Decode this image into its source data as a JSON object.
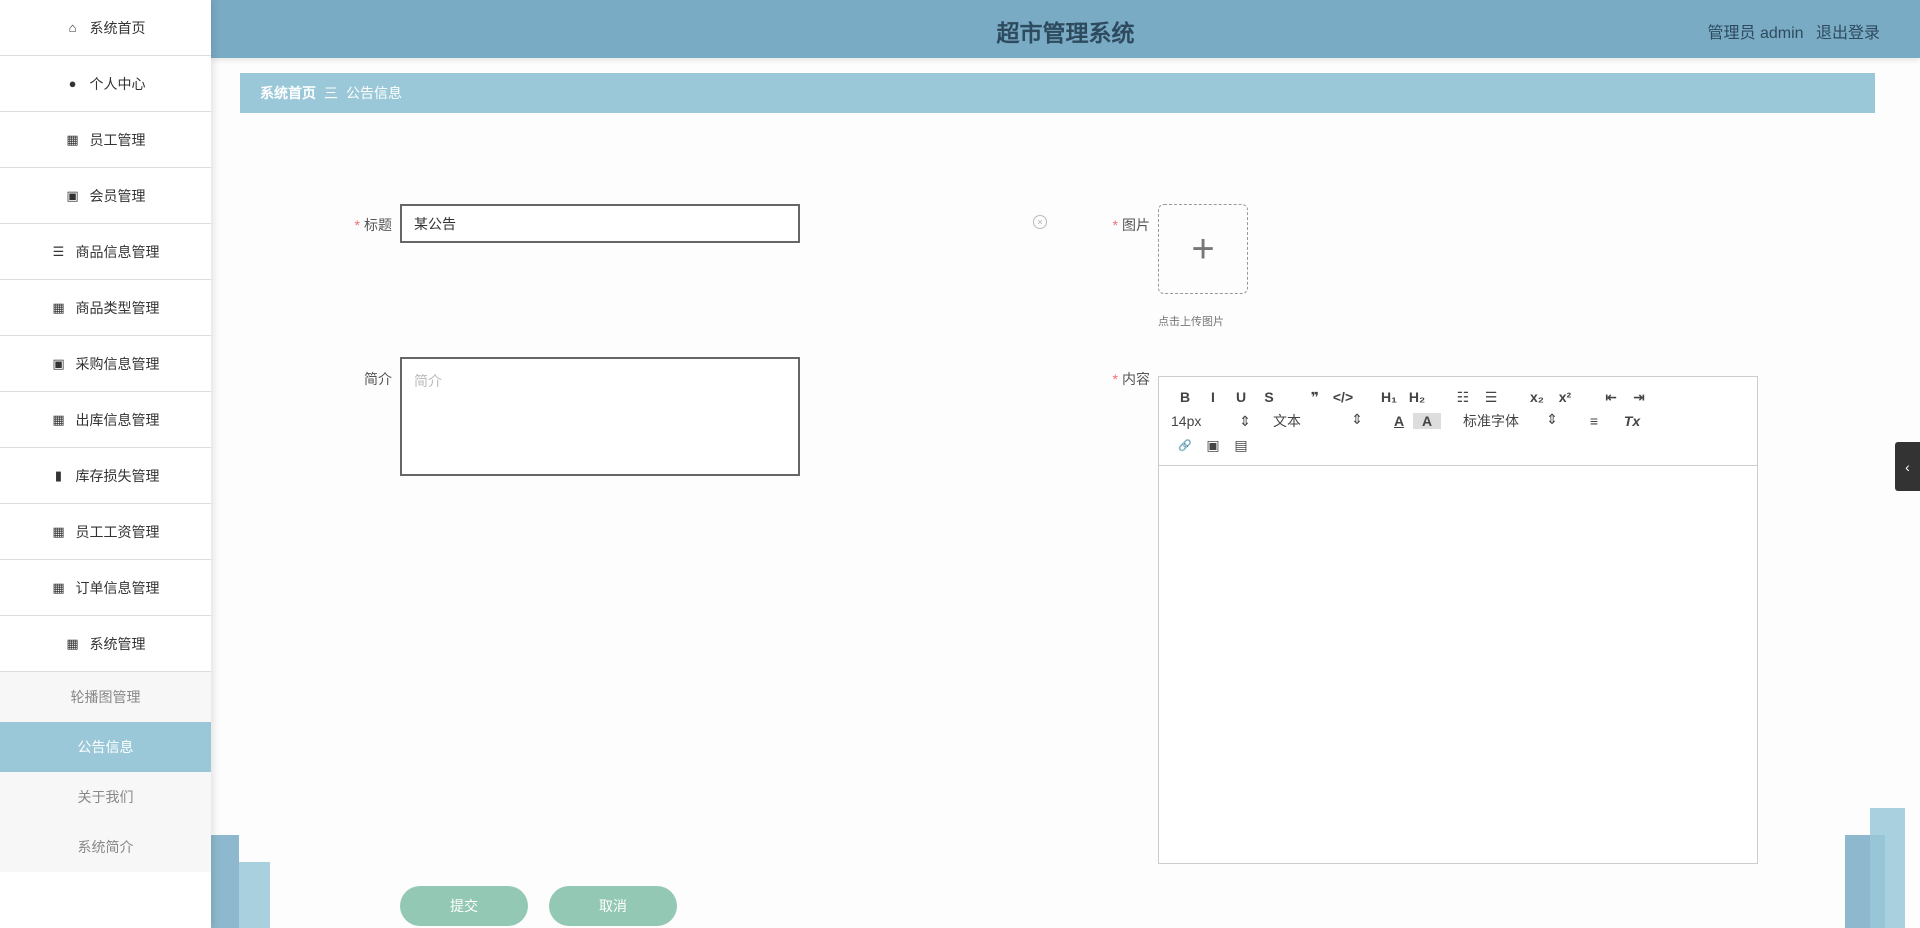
{
  "header": {
    "title": "超市管理系统",
    "user": "管理员 admin",
    "logout": "退出登录"
  },
  "sidebar": {
    "items": [
      {
        "label": "系统首页",
        "icon": "home-icon",
        "glyph": "⌂"
      },
      {
        "label": "个人中心",
        "icon": "user-icon",
        "glyph": "●"
      },
      {
        "label": "员工管理",
        "icon": "grid-icon",
        "glyph": "▦"
      },
      {
        "label": "会员管理",
        "icon": "clipboard-x-icon",
        "glyph": "▣"
      },
      {
        "label": "商品信息管理",
        "icon": "sliders-icon",
        "glyph": "☰"
      },
      {
        "label": "商品类型管理",
        "icon": "grid-icon",
        "glyph": "▦"
      },
      {
        "label": "采购信息管理",
        "icon": "clipboard-check-icon",
        "glyph": "▣"
      },
      {
        "label": "出库信息管理",
        "icon": "grid-icon",
        "glyph": "▦"
      },
      {
        "label": "库存损失管理",
        "icon": "book-icon",
        "glyph": "▮"
      },
      {
        "label": "员工工资管理",
        "icon": "grid-icon",
        "glyph": "▦"
      },
      {
        "label": "订单信息管理",
        "icon": "grid-icon",
        "glyph": "▦"
      },
      {
        "label": "系统管理",
        "icon": "grid-icon",
        "glyph": "▦"
      }
    ],
    "sub_items": [
      "轮播图管理",
      "公告信息",
      "关于我们",
      "系统简介"
    ],
    "active_sub": "公告信息"
  },
  "breadcrumb": {
    "home": "系统首页",
    "sep": "三",
    "current": "公告信息"
  },
  "form": {
    "title_label": "标题",
    "title_value": "某公告",
    "image_label": "图片",
    "upload_hint": "点击上传图片",
    "intro_label": "简介",
    "intro_placeholder": "简介",
    "content_label": "内容",
    "editor": {
      "row1": [
        "B",
        "I",
        "U",
        "S",
        "❞",
        "</>",
        "H₁",
        "H₂",
        "☷",
        "☰",
        "x₂",
        "x²",
        "⇤",
        "⇥"
      ],
      "size": "14px",
      "header": "文本",
      "font": "标准字体",
      "row2_icons": [
        "A",
        "A",
        "≡",
        "Tx"
      ],
      "row3": [
        "🔗",
        "▣",
        "▤"
      ]
    },
    "submit": "提交",
    "cancel": "取消"
  }
}
